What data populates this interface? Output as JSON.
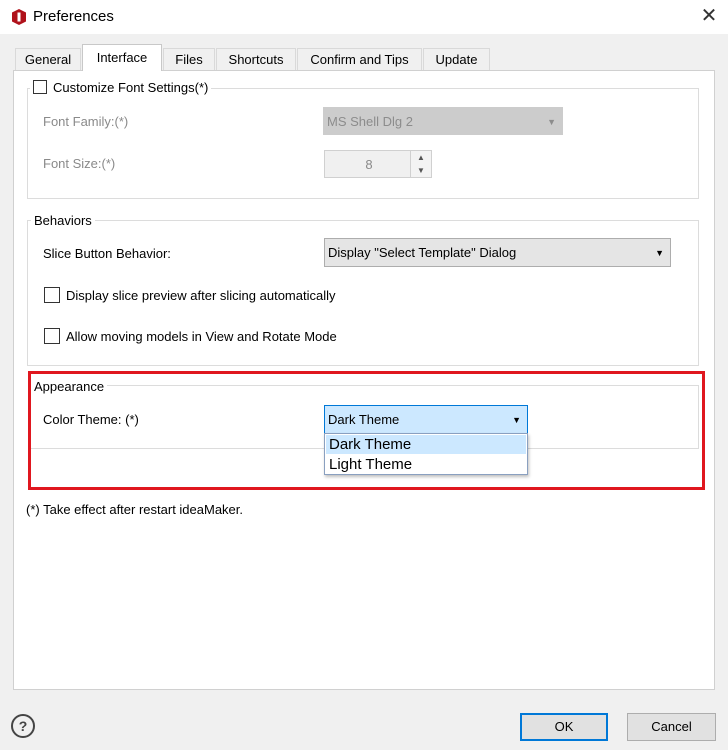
{
  "window": {
    "title": "Preferences",
    "app_icon": "ideamaker-logo",
    "close_icon": "close-x"
  },
  "tabs": [
    {
      "label": "General",
      "active": false
    },
    {
      "label": "Interface",
      "active": true
    },
    {
      "label": "Files",
      "active": false
    },
    {
      "label": "Shortcuts",
      "active": false
    },
    {
      "label": "Confirm and Tips",
      "active": false
    },
    {
      "label": "Update",
      "active": false
    }
  ],
  "font_settings": {
    "checkbox_label": "Customize Font Settings(*)",
    "checked": false,
    "font_family_label": "Font Family:(*)",
    "font_family_value": "MS Shell Dlg 2",
    "font_size_label": "Font Size:(*)",
    "font_size_value": "8"
  },
  "behaviors": {
    "group_title": "Behaviors",
    "slice_button_label": "Slice Button Behavior:",
    "slice_button_value": "Display \"Select Template\" Dialog",
    "preview_checkbox_label": "Display slice preview after slicing automatically",
    "preview_checked": false,
    "moving_checkbox_label": "Allow moving models in View and Rotate Mode",
    "moving_checked": false
  },
  "appearance": {
    "group_title": "Appearance",
    "color_theme_label": "Color Theme: (*)",
    "color_theme_value": "Dark Theme",
    "options": [
      "Dark Theme",
      "Light Theme"
    ],
    "highlighted_option": "Dark Theme"
  },
  "footnote": "(*) Take effect after restart ideaMaker.",
  "buttons": {
    "ok": "OK",
    "cancel": "Cancel",
    "help_icon": "question-mark"
  },
  "colors": {
    "highlight_border": "#e0171f",
    "selection": "#cce8ff",
    "accent": "#0078d7"
  }
}
